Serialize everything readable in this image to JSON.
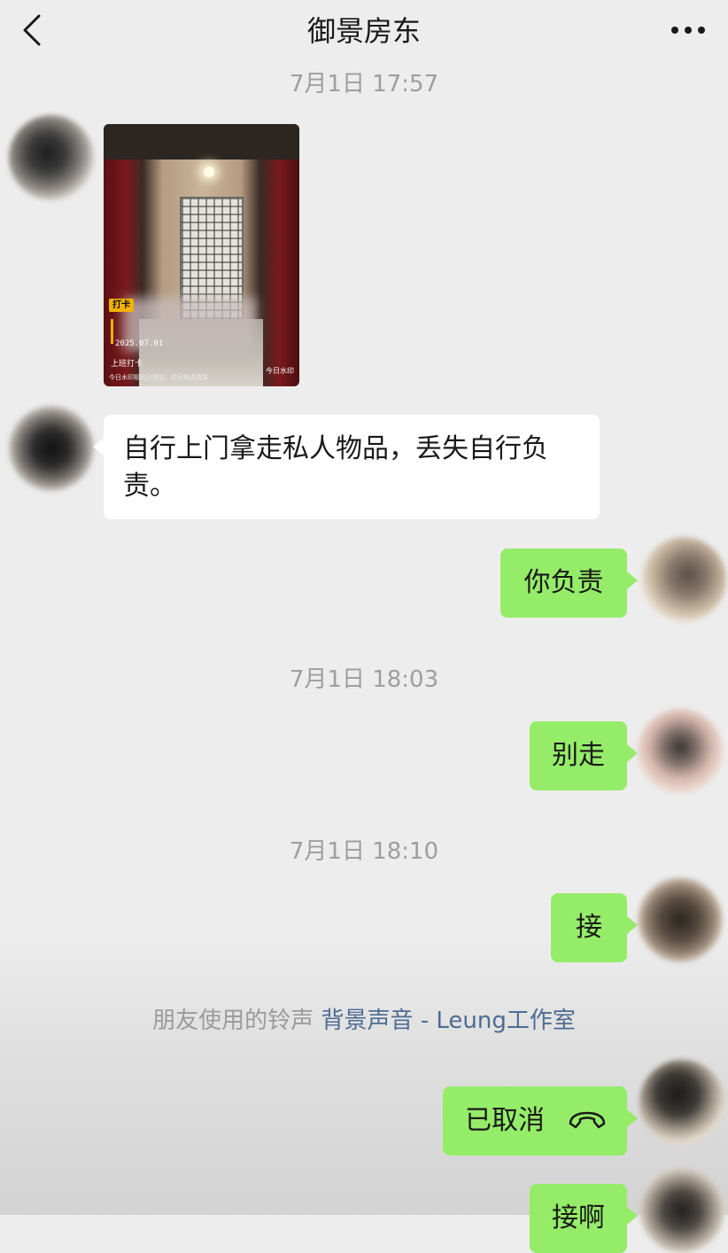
{
  "header": {
    "title": "御景房东",
    "back_icon": "chevron-left-icon",
    "more_icon": "more-horizontal-icon"
  },
  "messages": {
    "ts1": "7月1日 17:57",
    "photo_stamp": "打卡",
    "photo_date": "2025.07.01",
    "photo_label": "上班打卡",
    "photo_footer": "今日水印相机已验证：时间地点真实",
    "photo_brand": "今日水印",
    "msg1": "自行上门拿走私人物品，丢失自行负责。",
    "msg2": "你负责",
    "ts2": "7月1日 18:03",
    "msg3": "别走",
    "ts3": "7月1日 18:10",
    "msg4": "接",
    "ringtone_prefix": "朋友使用的铃声",
    "ringtone_link": "背景声音 - Leung工作室",
    "call_status": "已取消",
    "call_icon": "hangup-phone-icon",
    "msg5": "接啊"
  },
  "colors": {
    "green_bubble": "#95ec69",
    "white_bubble": "#ffffff",
    "background": "#ededed",
    "link": "#4e6b92"
  }
}
